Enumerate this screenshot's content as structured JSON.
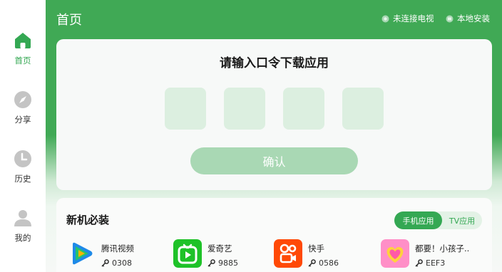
{
  "sidebar": {
    "items": [
      {
        "label": "首页",
        "icon": "home-icon",
        "active": true
      },
      {
        "label": "分享",
        "icon": "compass-icon",
        "active": false
      },
      {
        "label": "历史",
        "icon": "clock-icon",
        "active": false
      },
      {
        "label": "我的",
        "icon": "user-icon",
        "active": false
      }
    ]
  },
  "header": {
    "title": "首页",
    "tv_status": "未连接电视",
    "local_install": "本地安装"
  },
  "code_entry": {
    "title": "请输入口令下载应用",
    "digits": [
      "",
      "",
      "",
      ""
    ],
    "confirm_label": "确认"
  },
  "essentials": {
    "title": "新机必装",
    "tabs": [
      {
        "label": "手机应用",
        "active": true
      },
      {
        "label": "TV应用",
        "active": false
      }
    ],
    "apps": [
      {
        "name": "腾讯视频",
        "code": "0308",
        "icon": "tencent-video-icon"
      },
      {
        "name": "爱奇艺",
        "code": "9885",
        "icon": "iqiyi-icon"
      },
      {
        "name": "快手",
        "code": "0586",
        "icon": "kuaishou-icon"
      },
      {
        "name": "都要！小孩子..",
        "code": "EEF3",
        "icon": "heart-app-icon"
      }
    ]
  },
  "colors": {
    "accent": "#34a853",
    "header_green": "#40a955",
    "code_box": "#dcefe0",
    "confirm_disabled": "#a9d8b4"
  }
}
